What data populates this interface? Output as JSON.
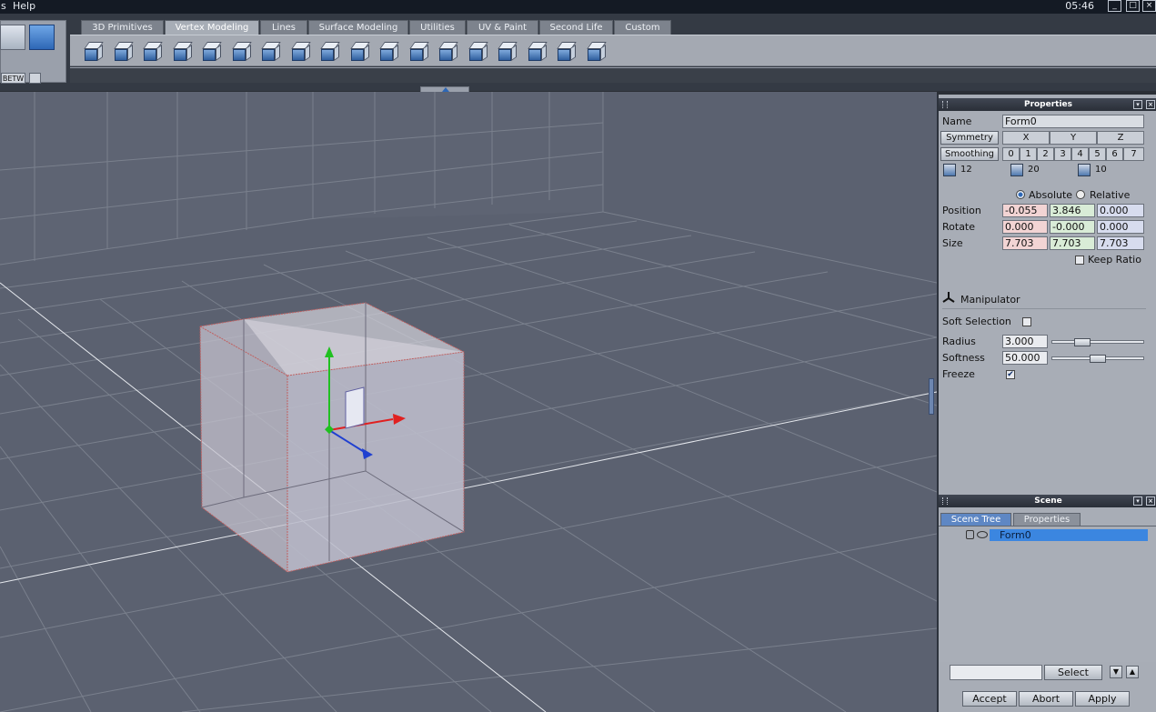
{
  "menubar": {
    "items": [
      "s",
      "Help"
    ],
    "clock": "05:46",
    "window_buttons": [
      "_",
      "□",
      "×"
    ]
  },
  "left_box": {
    "small_labels": [
      "BETW",
      ""
    ]
  },
  "tabs": [
    "3D Primitives",
    "Vertex Modeling",
    "Lines",
    "Surface Modeling",
    "Utilities",
    "UV & Paint",
    "Second Life",
    "Custom"
  ],
  "active_tab": "Vertex Modeling",
  "tool_icons": [
    "cube-extrude-icon",
    "cube-select-icon",
    "cube-solid-icon",
    "cube-face-icon",
    "cube-edit-icon",
    "cube-cut-icon",
    "cube-bend-icon",
    "cube-weld-icon",
    "cube-slice-icon",
    "cube-bevel-icon",
    "cube-subdivide-icon",
    "cube-twist-icon",
    "cube-knife-icon",
    "cube-mirror-icon",
    "cube-smooth-icon",
    "cube-lathe-icon",
    "add-vertex-icon",
    "remove-vertex-icon"
  ],
  "properties": {
    "title": "Properties",
    "name_label": "Name",
    "name_value": "Form0",
    "symmetry_label": "Symmetry",
    "axes": [
      "X",
      "Y",
      "Z"
    ],
    "smoothing_label": "Smoothing",
    "smoothing_levels": [
      "0",
      "1",
      "2",
      "3",
      "4",
      "5",
      "6",
      "7"
    ],
    "counts": [
      "12",
      "20",
      "10"
    ],
    "absolute_label": "Absolute",
    "relative_label": "Relative",
    "position_label": "Position",
    "position": [
      "-0.055",
      "3.846",
      "0.000"
    ],
    "rotate_label": "Rotate",
    "rotate": [
      "0.000",
      "-0.000",
      "0.000"
    ],
    "size_label": "Size",
    "size": [
      "7.703",
      "7.703",
      "7.703"
    ],
    "keep_ratio_label": "Keep Ratio",
    "manipulator_label": "Manipulator",
    "soft_selection_label": "Soft Selection",
    "radius_label": "Radius",
    "radius_value": "3.000",
    "radius_level": 0.3,
    "softness_label": "Softness",
    "softness_value": "50.000",
    "softness_level": 0.5,
    "freeze_label": "Freeze",
    "freeze_checked": "✔"
  },
  "scene": {
    "title": "Scene",
    "tabs": [
      "Scene Tree",
      "Properties"
    ],
    "tree_item": "Form0",
    "select_label": "Select"
  },
  "actions": {
    "accept": "Accept",
    "abort": "Abort",
    "apply": "Apply"
  },
  "colors": {
    "viewport_bg": "#5b6170",
    "selection": "#3b86e0",
    "axis_x": "#e02020",
    "axis_y": "#20c020",
    "axis_z": "#2040d0"
  }
}
